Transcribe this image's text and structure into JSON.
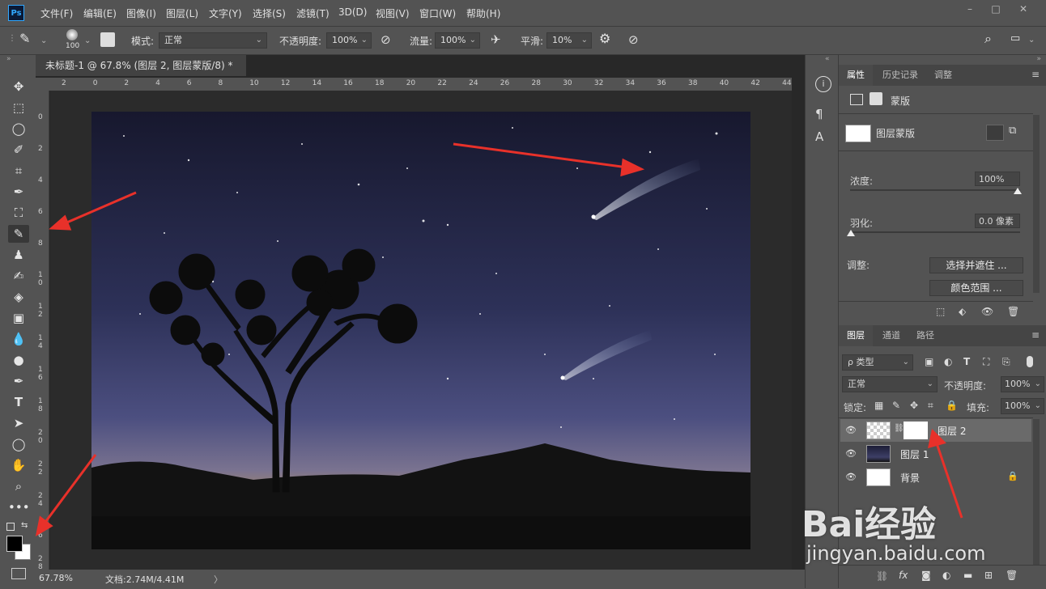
{
  "app": {
    "logo": "Ps"
  },
  "menu": [
    "文件(F)",
    "编辑(E)",
    "图像(I)",
    "图层(L)",
    "文字(Y)",
    "选择(S)",
    "滤镜(T)",
    "3D(D)",
    "视图(V)",
    "窗口(W)",
    "帮助(H)"
  ],
  "window_controls": [
    "–",
    "□",
    "✕"
  ],
  "options": {
    "brush_size": "100",
    "mode_label": "模式:",
    "mode_value": "正常",
    "opacity_label": "不透明度:",
    "opacity_value": "100%",
    "flow_label": "流量:",
    "flow_value": "100%",
    "smooth_label": "平滑:",
    "smooth_value": "10%"
  },
  "document": {
    "tab_title": "未标题-1 @ 67.8% (图层 2, 图层蒙版/8) *",
    "tab_close": "×",
    "ruler_h": [
      "2",
      "0",
      "2",
      "4",
      "6",
      "8",
      "10",
      "12",
      "14",
      "16",
      "18",
      "20",
      "22",
      "24",
      "26",
      "28",
      "30",
      "32",
      "34",
      "36",
      "38",
      "40",
      "42",
      "44"
    ],
    "ruler_v": [
      "0",
      "2",
      "4",
      "6",
      "8",
      "10",
      "12",
      "14",
      "16",
      "18",
      "20",
      "22",
      "24",
      "26",
      "28"
    ]
  },
  "status": {
    "zoom": "67.78%",
    "doc_info": "文档:2.74M/4.41M",
    "arrow": "〉"
  },
  "properties_panel": {
    "tabs": [
      "属性",
      "历史记录",
      "调整"
    ],
    "section_title": "蒙版",
    "mask_label": "图层蒙版",
    "density_label": "浓度:",
    "density_value": "100%",
    "feather_label": "羽化:",
    "feather_value": "0.0 像素",
    "adjust_label": "调整:",
    "select_mask_btn": "选择并遮住 ...",
    "color_range_btn": "颜色范围 ..."
  },
  "layers_panel": {
    "tabs": [
      "图层",
      "通道",
      "路径"
    ],
    "filter_label": "ρ 类型",
    "blend_mode": "正常",
    "opacity_label": "不透明度:",
    "opacity_value": "100%",
    "lock_label": "锁定:",
    "fill_label": "填充:",
    "fill_value": "100%",
    "layers": [
      {
        "name": "图层 2"
      },
      {
        "name": "图层 1"
      },
      {
        "name": "背景"
      }
    ]
  },
  "watermark": {
    "brand": "Bai经验",
    "url": "jingyan.baidu.com"
  },
  "colors": {
    "accent": "#31a8ff",
    "annotation_arrow": "#e8312a",
    "panel_bg": "#535353"
  }
}
